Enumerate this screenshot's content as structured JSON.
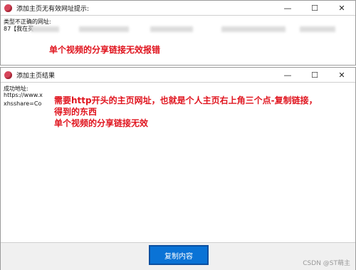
{
  "win1": {
    "title": "添加主页无有效网址提示:",
    "line1": "类型不正确的网址:",
    "line2": "87【我在买",
    "note": "单个视频的分享链接无效报错",
    "controls": [
      "—",
      "☐",
      "✕"
    ]
  },
  "win2": {
    "title": "添加主页结果",
    "line1": "成功地址:",
    "line2": "https://www.x",
    "line3": "xhsshare=Co",
    "note1": "需要http开头的主页网址，也就是个人主页右上角三个点-复制链接，",
    "note2": "得到的东西",
    "note3": "单个视频的分享链接无效",
    "controls": [
      "—",
      "☐",
      "✕"
    ],
    "button": "复制内容"
  },
  "watermark": "CSDN @ST萌主",
  "colors": {
    "accent": "#0a73d6",
    "note": "#e0141e"
  }
}
